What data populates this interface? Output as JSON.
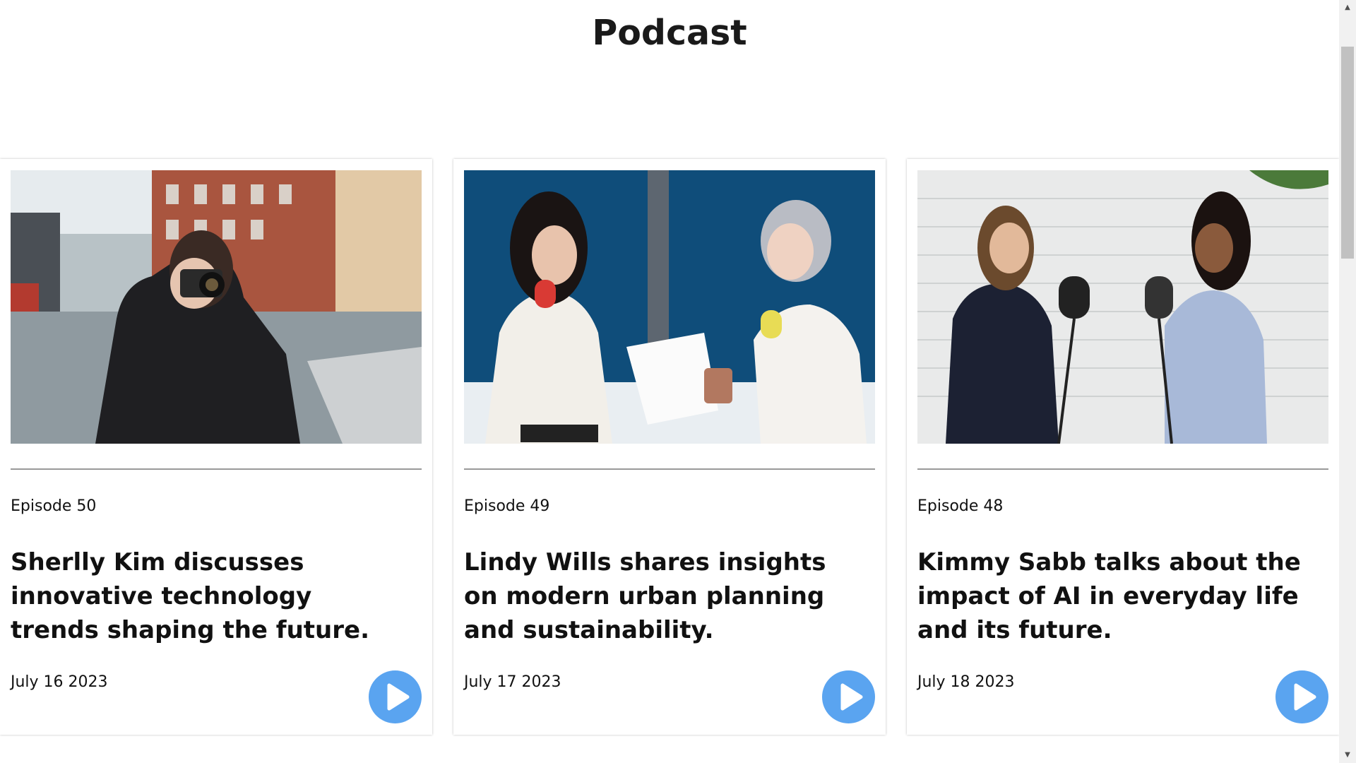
{
  "page": {
    "title": "Podcast"
  },
  "episodes": [
    {
      "episode_label": "Episode 50",
      "headline": "Sherlly Kim discusses innovative technology trends shaping the future.",
      "date": "July 16 2023",
      "image": "woman-with-camera-on-city-street"
    },
    {
      "episode_label": "Episode 49",
      "headline": "Lindy Wills shares insights on modern urban planning and sustainability.",
      "date": "July 17 2023",
      "image": "two-women-recording-podcast-in-studio"
    },
    {
      "episode_label": "Episode 48",
      "headline": "Kimmy Sabb talks about the impact of AI in everyday life and its future.",
      "date": "July 18 2023",
      "image": "two-women-talking-at-microphones-brick-wall"
    }
  ],
  "icons": {
    "play": "play-icon",
    "scroll_up": "scroll-up-arrow-icon",
    "scroll_down": "scroll-down-arrow-icon"
  },
  "colors": {
    "play_button": "#5aa4f0",
    "divider": "#999999",
    "text": "#111111"
  }
}
